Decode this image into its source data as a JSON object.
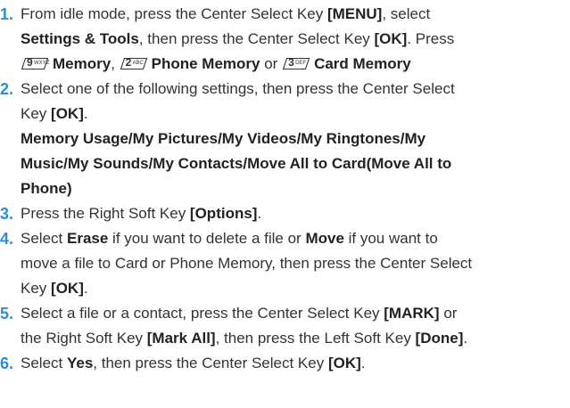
{
  "steps": [
    {
      "num": "1.",
      "t1": "From idle mode, press the Center Select Key ",
      "b1": "[MENU]",
      "t2": ", select",
      "b2": "Settings & Tools",
      "t3": ", then press the Center Select Key ",
      "b3": "[OK]",
      "t4": ". Press",
      "k1_digit": "9",
      "k1_letters": "WXYZ",
      "b4": "Memory",
      "t5": ", ",
      "k2_digit": "2",
      "k2_letters": "ABC",
      "b5": "Phone Memory",
      "t6": " or ",
      "k3_digit": "3",
      "k3_letters": "DEF",
      "b6": "Card Memory"
    },
    {
      "num": "2.",
      "t1": "Select one of the following settings, then press the Center Select",
      "t2": "Key ",
      "b1": "[OK]",
      "t3": ".",
      "l1": "Memory Usage/My Pictures/My Videos/My Ringtones/My",
      "l2": "Music/My Sounds/My Contacts/Move All to Card(Move All to",
      "l3": "Phone)"
    },
    {
      "num": "3.",
      "t1": "Press the Right Soft Key ",
      "b1": "[Options]",
      "t2": "."
    },
    {
      "num": "4.",
      "t1": "Select ",
      "b1": "Erase",
      "t2": " if you want to delete a file or ",
      "b2": "Move",
      "t3": " if you want to",
      "t4": "move a file to Card or Phone Memory, then press the Center Select",
      "t5": "Key ",
      "b3": "[OK]",
      "t6": "."
    },
    {
      "num": "5.",
      "t1": "Select a file or a contact, press the Center Select Key ",
      "b1": "[MARK]",
      "t2": " or",
      "t3": "the Right Soft Key ",
      "b2": "[Mark All]",
      "t4": ", then press the Left Soft Key ",
      "b3": "[Done]",
      "t5": "."
    },
    {
      "num": "6.",
      "t1": "Select ",
      "b1": "Yes",
      "t2": ", then press the Center Select Key ",
      "b2": "[OK]",
      "t3": "."
    }
  ]
}
